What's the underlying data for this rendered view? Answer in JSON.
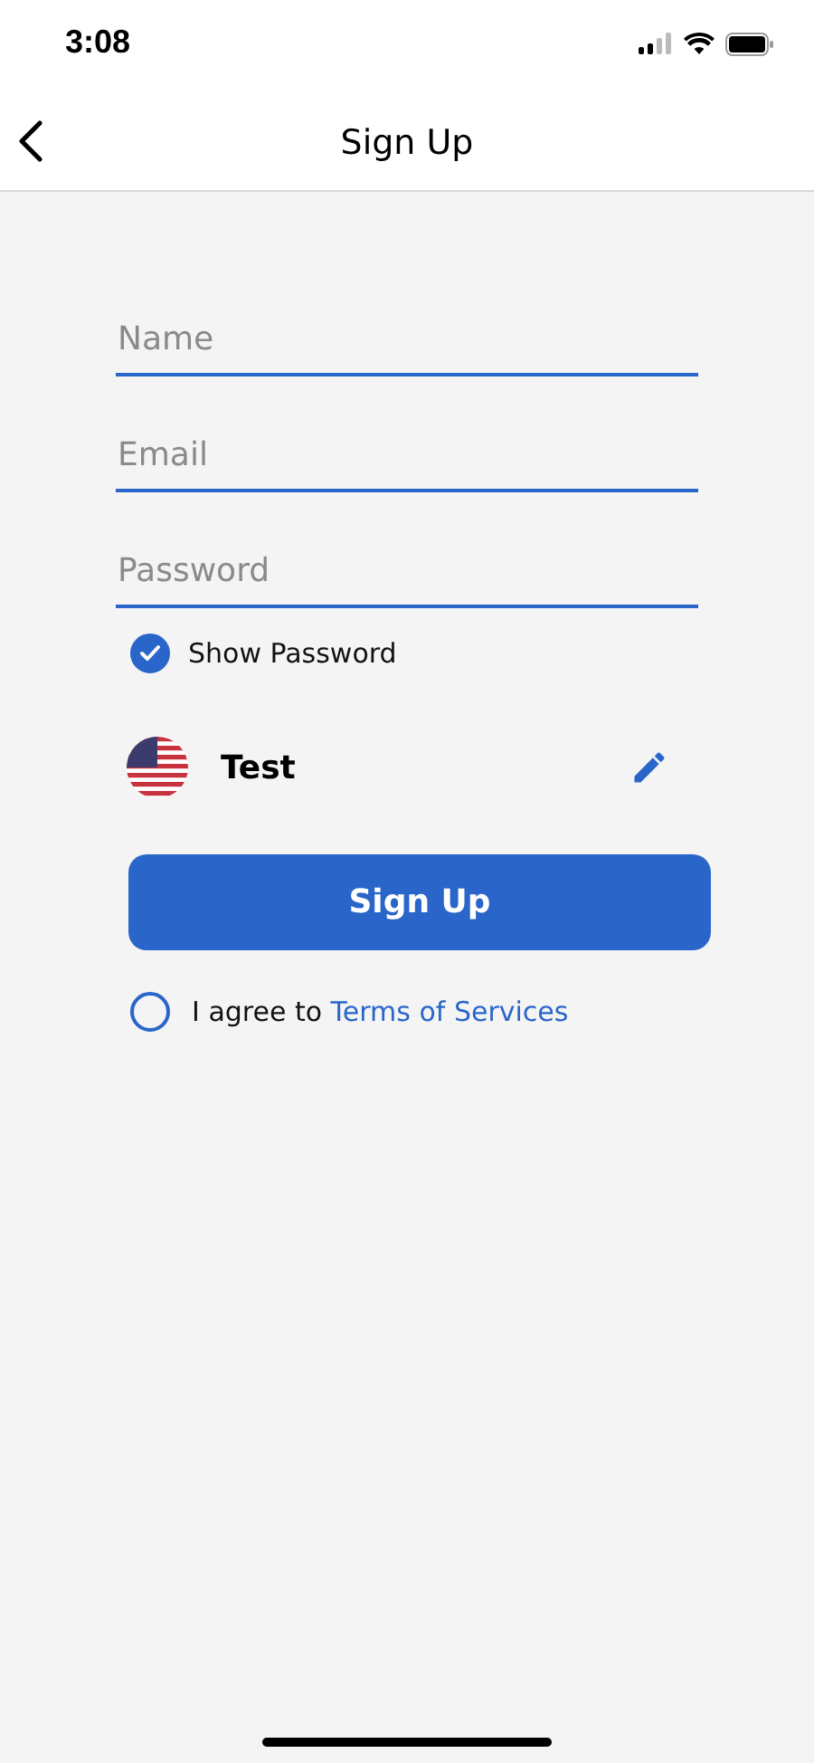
{
  "status_bar": {
    "time": "3:08"
  },
  "nav_bar": {
    "title": "Sign Up"
  },
  "fields": [
    {
      "placeholder": "Name"
    },
    {
      "placeholder": "Email"
    },
    {
      "placeholder": "Password"
    }
  ],
  "show_password": {
    "label": "Show Password",
    "checked": true
  },
  "profile": {
    "name": "Test"
  },
  "submit_button": "Sign Up",
  "agreement": {
    "text": "I agree to",
    "link": "Terms of Services",
    "checked": false
  }
}
